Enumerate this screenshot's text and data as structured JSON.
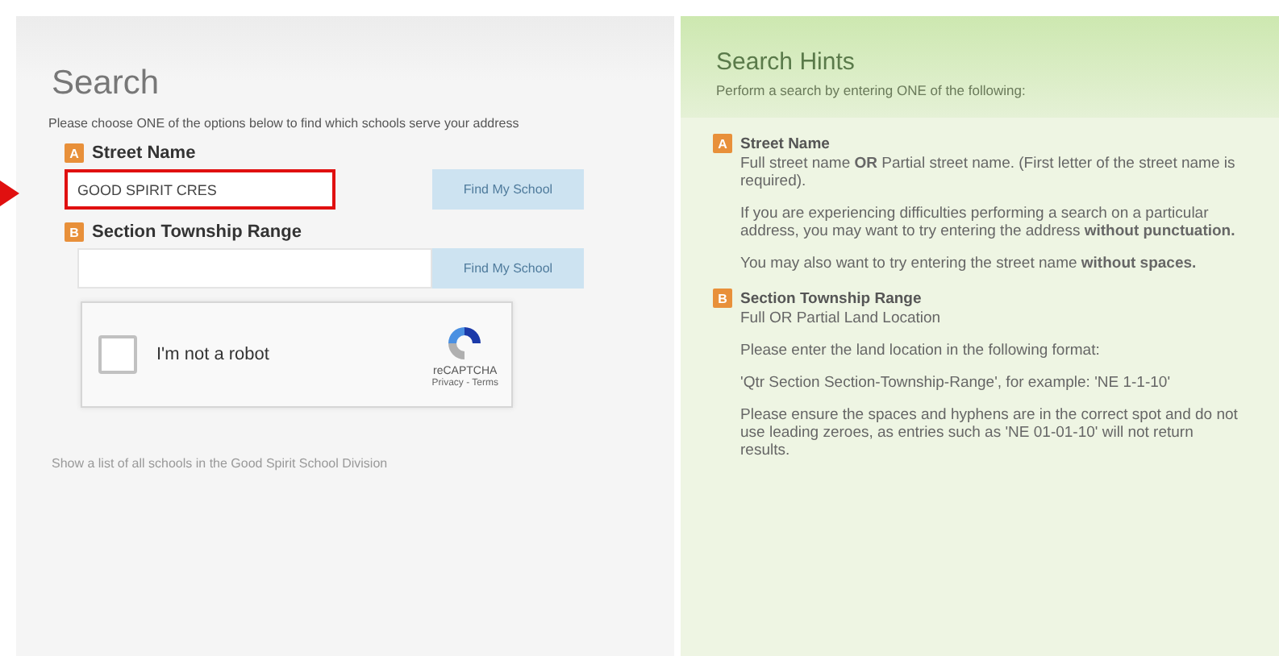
{
  "search": {
    "title": "Search",
    "intro": "Please choose ONE of the options below to find which schools serve your address",
    "options": [
      {
        "badge": "A",
        "label": "Street Name",
        "value": "GOOD SPIRIT CRES",
        "highlighted": true,
        "button": "Find My School",
        "disabled": true
      },
      {
        "badge": "B",
        "label": "Section Township Range",
        "highlighted": false,
        "button": "Find My School",
        "disabled": true
      }
    ],
    "captcha": {
      "label": "I'm not a robot",
      "checked": false,
      "brand": "reCAPTCHA",
      "links": "Privacy - Terms"
    },
    "footer_link": "Show a list of all schools in the Good Spirit School Division"
  },
  "hints": {
    "title": "Search Hints",
    "subtitle": "Perform a search by entering ONE of the following:",
    "sections": [
      {
        "badge": "A",
        "heading": "Street Name",
        "paragraphs": [
          "Full street name **OR** Partial street name. (First letter of the street name is required).",
          "If you are experiencing difficulties performing a search on a particular address, you may want to try entering the address **without punctuation.**",
          "You may also want to try entering the street name **without spaces.**"
        ]
      },
      {
        "badge": "B",
        "heading": "Section Township Range",
        "paragraphs": [
          "Full OR Partial Land Location",
          "Please enter the land location in the following format:",
          "'Qtr Section Section-Township-Range', for example: 'NE 1-1-10'",
          "Please ensure the spaces and hyphens are in the correct spot and do not use leading zeroes, as entries such as 'NE 01-01-10' will not return results."
        ]
      }
    ]
  }
}
